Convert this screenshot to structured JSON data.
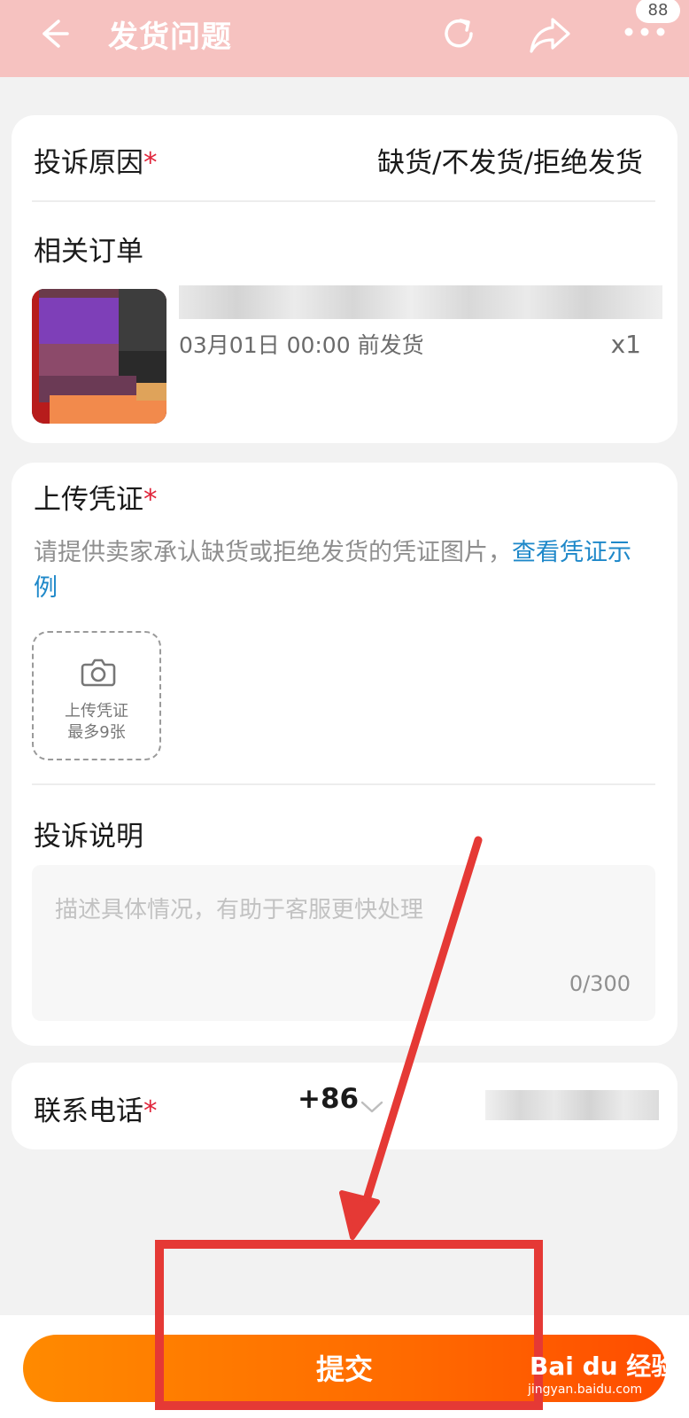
{
  "header": {
    "title": "发货问题",
    "badge_count": "88",
    "background_color": "#f6c2c0"
  },
  "complaint_reason": {
    "label": "投诉原因",
    "required_mark": "*",
    "value": "缺货/不发货/拒绝发货"
  },
  "related_order": {
    "label": "相关订单",
    "ship_time": "03月01日 00:00 前发货",
    "quantity": "x1"
  },
  "upload_proof": {
    "label": "上传凭证",
    "required_mark": "*",
    "hint": "请提供卖家承认缺货或拒绝发货的凭证图片，",
    "link_text": "查看凭证示例",
    "box_line1": "上传凭证",
    "box_line2": "最多9张"
  },
  "complaint_desc": {
    "label": "投诉说明",
    "placeholder": "描述具体情况，有助于客服更快处理",
    "counter": "0/300"
  },
  "phone": {
    "label": "联系电话",
    "required_mark": "*",
    "country_code": "+86"
  },
  "submit": {
    "label": "提交",
    "color": "#ff6a00"
  },
  "watermark": {
    "brand": "Bai du 经验",
    "url": "jingyan.baidu.com"
  },
  "colors": {
    "link": "#1e88c9",
    "required": "#e0243a",
    "annotation": "#e53935"
  }
}
